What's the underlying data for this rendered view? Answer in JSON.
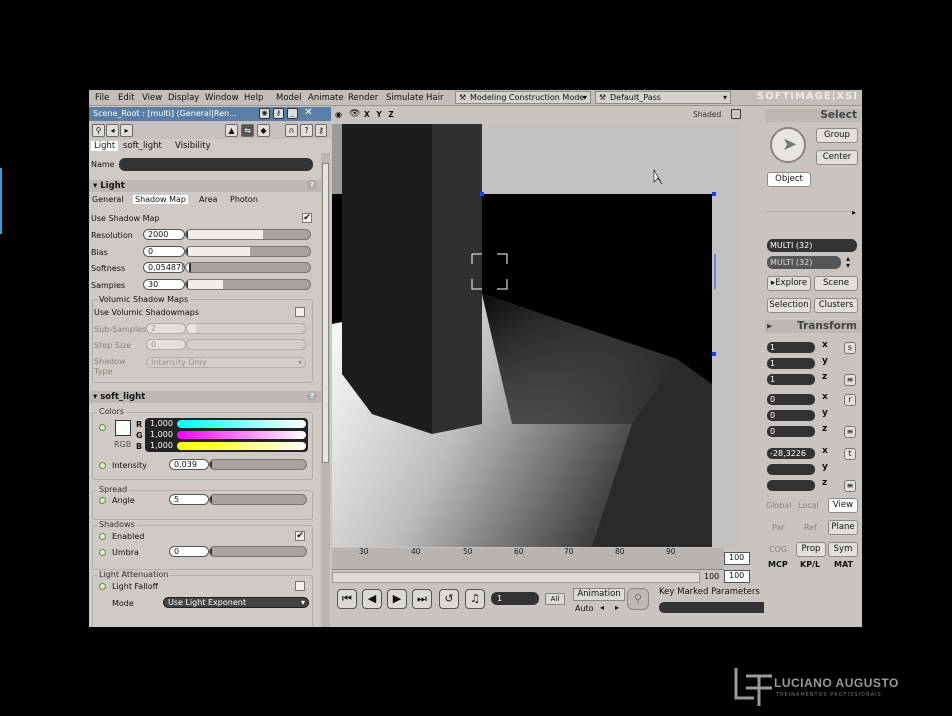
{
  "menu": [
    "File",
    "Edit",
    "View",
    "Display",
    "Window",
    "Help",
    "Model",
    "Animate",
    "Render",
    "Simulate",
    "Hair"
  ],
  "mode_dropdown": "Modeling Construction Mode",
  "pass_dropdown": "Default_Pass",
  "brand": "SOFTIMAGE|XSI",
  "property": {
    "title": "Scene_Root : [multi] (General|Ren...",
    "tabs": [
      "Light",
      "soft_light",
      "Visibility"
    ],
    "name_label": "Name",
    "light_section": "Light",
    "subtabs": [
      "General",
      "Shadow Map",
      "Area",
      "Photon"
    ],
    "use_shadow_map": "Use Shadow Map",
    "resolution_label": "Resolution",
    "resolution": "2000",
    "bias_label": "Bias",
    "bias": "0",
    "softness_label": "Softness",
    "softness": "0,054878",
    "samples_label": "Samples",
    "samples": "30",
    "volumic_group": "Volumic Shadow Maps",
    "use_volumic": "Use Volumic Shadowmaps",
    "subsamples_label": "Sub-Samples",
    "subsamples": "2",
    "stepsize_label": "Step Size",
    "stepsize": "0",
    "shadow_type_label": "Shadow Type",
    "shadow_type": "Intensity Only",
    "soft_light_section": "soft_light",
    "colors_group": "Colors",
    "r_label": "R",
    "g_label": "G",
    "b_label": "B",
    "rgb_label": "RGB",
    "r_val": "1,000",
    "g_val": "1,000",
    "b_val": "1,000",
    "intensity_label": "Intensity",
    "intensity": "0,039",
    "spread_group": "Spread",
    "angle_label": "Angle",
    "angle": "5",
    "shadows_group": "Shadows",
    "enabled_label": "Enabled",
    "umbra_label": "Umbra",
    "umbra": "0",
    "attenuation_group": "Light Attenuation",
    "light_falloff": "Light Falloff",
    "mode_label": "Mode",
    "mode": "Use Light Exponent"
  },
  "viewport": {
    "axes": "X Y Z",
    "display_mode": "Shaded"
  },
  "timeline": {
    "ticks": [
      "30",
      "40",
      "50",
      "60",
      "70",
      "80",
      "90"
    ],
    "end_frame": "100",
    "end_frame2": "100",
    "start_small": "100",
    "current_frame": "1",
    "all_label": "All",
    "animation_label": "Animation",
    "auto_label": "Auto",
    "key_marked": "Key Marked Parameters"
  },
  "right_panel": {
    "select_header": "Select",
    "group": "Group",
    "center": "Center",
    "object": "Object",
    "multi1": "MULTI (32)",
    "multi2": "MULTI (32)",
    "explore": "Explore",
    "scene": "Scene",
    "selection": "Selection",
    "clusters": "Clusters",
    "transform_header": "Transform",
    "scale": [
      "1",
      "1",
      "1"
    ],
    "rotate": [
      "0",
      "0",
      "0"
    ],
    "translate": [
      "-28,3226",
      "",
      ""
    ],
    "axes": [
      "x",
      "y",
      "z"
    ],
    "global": "Global",
    "local": "Local",
    "view": "View",
    "par": "Par",
    "ref": "Ref",
    "plane": "Plane",
    "cog": "COG",
    "prop": "Prop",
    "sym": "Sym",
    "mcp": "MCP",
    "kpl": "KP/L",
    "mat": "MAT"
  },
  "watermark": {
    "name": "LUCIANO AUGUSTO",
    "sub": "TREINAMENTOS PROFISSIONAIS"
  }
}
